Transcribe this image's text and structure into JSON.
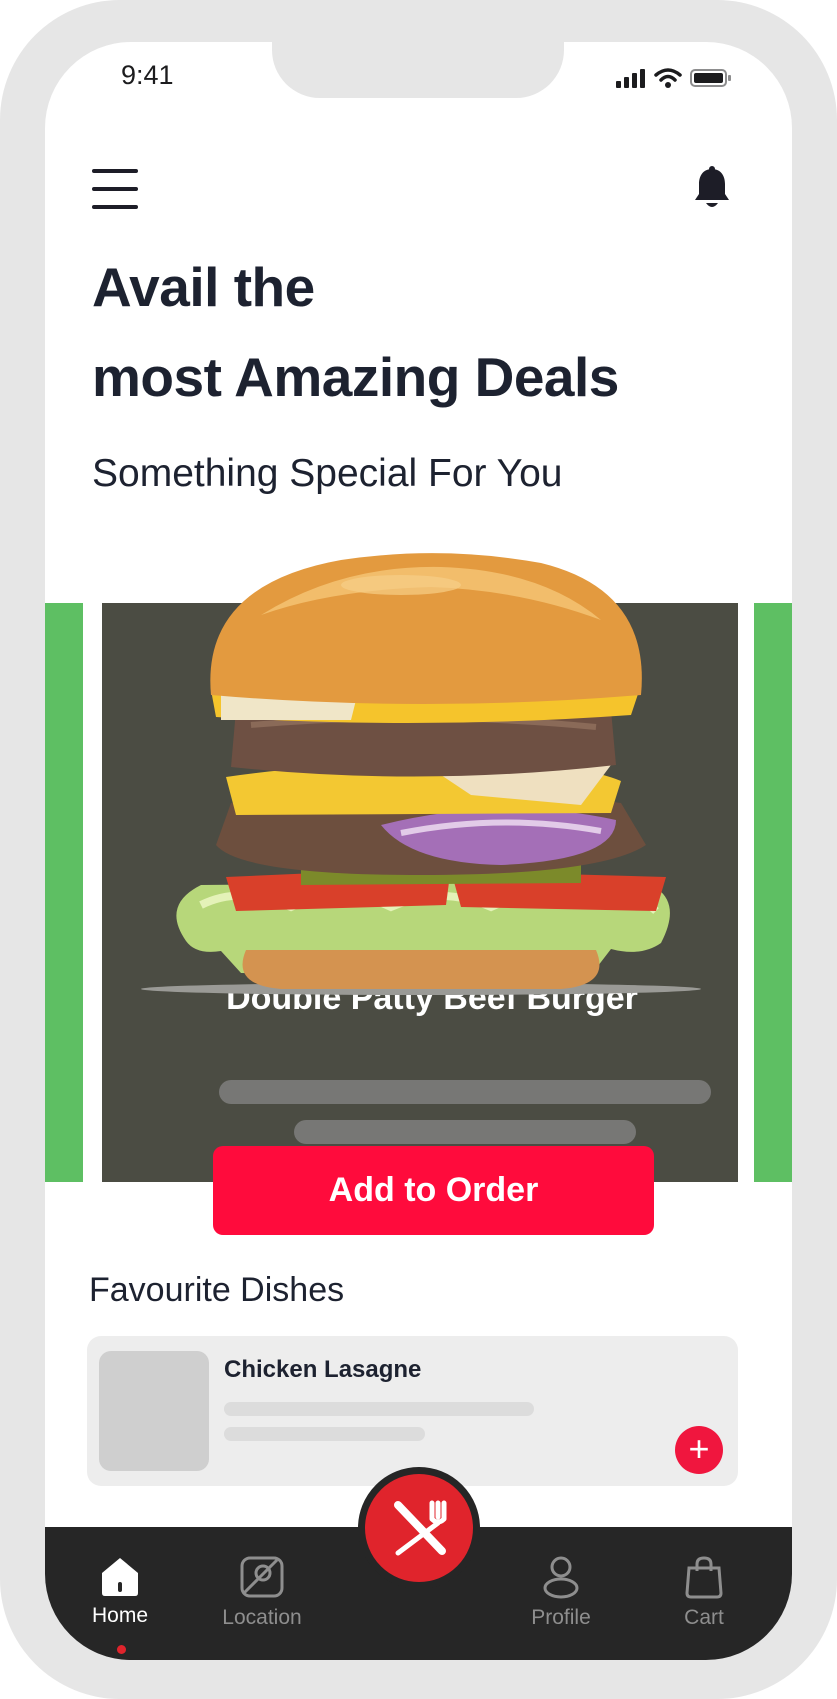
{
  "status_bar": {
    "time": "9:41"
  },
  "header": {
    "headline_line1": "Avail the",
    "headline_line2": "most Amazing Deals",
    "subtitle": "Something Special For You"
  },
  "promo": {
    "dish_name": "Double Patty Beef Burger",
    "add_button": "Add to Order"
  },
  "favourites": {
    "title": "Favourite Dishes",
    "items": [
      {
        "name": "Chicken Lasagne"
      }
    ]
  },
  "tabbar": {
    "home": "Home",
    "location": "Location",
    "profile": "Profile",
    "cart": "Cart",
    "active": "Home"
  },
  "colors": {
    "accent": "#ff0b3c",
    "promo_bg": "#4b4c43",
    "side_cards": "#5ebf63",
    "tabbar_bg": "#262626",
    "text": "#1d2230"
  }
}
